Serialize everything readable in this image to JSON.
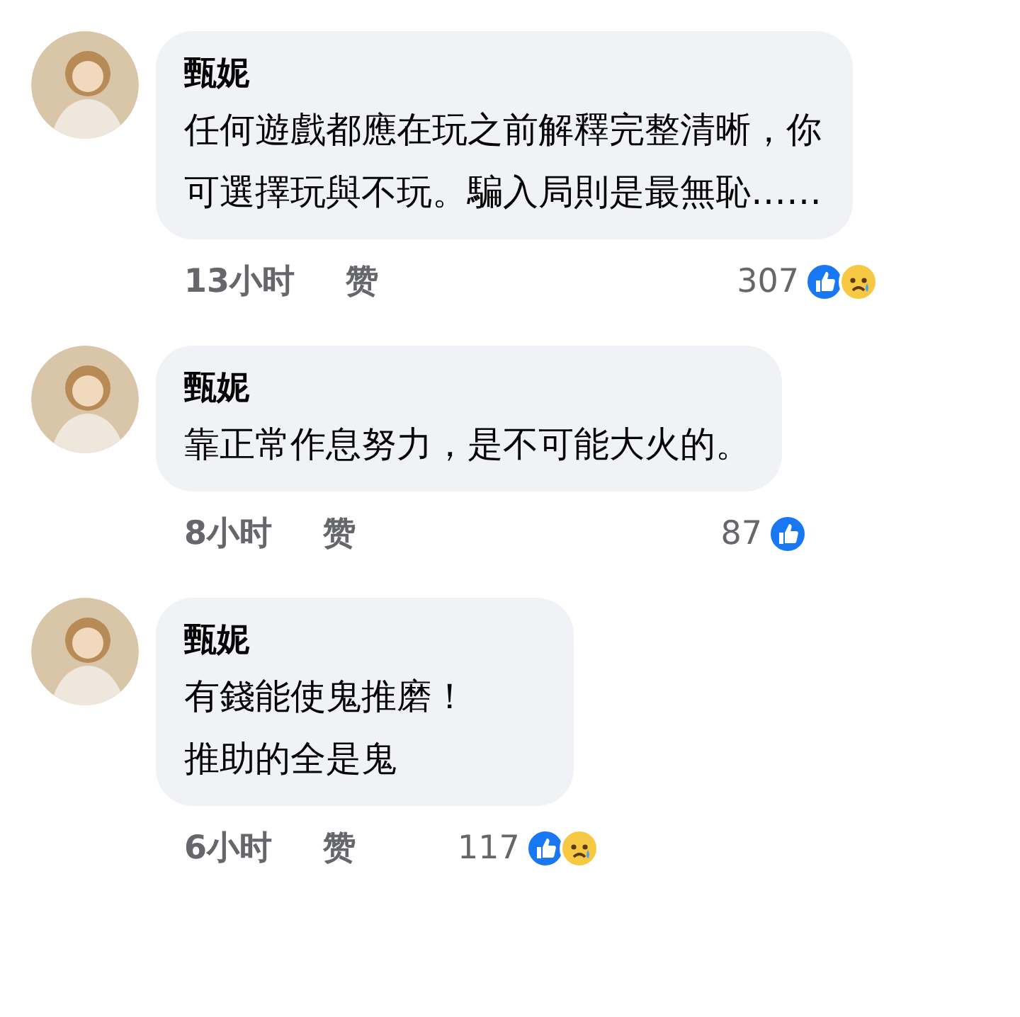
{
  "comments": [
    {
      "author": "甄妮",
      "lines": [
        "任何遊戲都應在玩之前解釋完整清晰，你",
        "可選擇玩與不玩。騙入局則是最無恥……"
      ],
      "time": "13小时",
      "like_label": "赞",
      "count": "307",
      "reactions": [
        {
          "kind": "like"
        },
        {
          "kind": "sad"
        }
      ]
    },
    {
      "author": "甄妮",
      "lines": [
        "靠正常作息努力，是不可能大火的。"
      ],
      "time": "8小时",
      "like_label": "赞",
      "count": "87",
      "reactions": [
        {
          "kind": "like"
        }
      ]
    },
    {
      "author": "甄妮",
      "lines": [
        "有錢能使鬼推磨！",
        "推助的全是鬼"
      ],
      "time": "6小时",
      "like_label": "赞",
      "count": "117",
      "reactions": [
        {
          "kind": "like"
        },
        {
          "kind": "sad"
        }
      ]
    }
  ]
}
